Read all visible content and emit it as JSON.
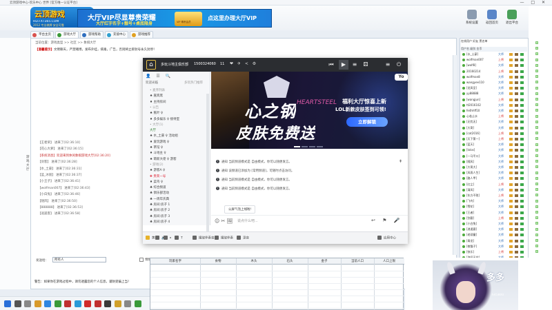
{
  "window": {
    "title": "云顶游戏中心-欢乐中心 世界 [官方唯一认证平台]",
    "controls": "— □ ✕"
  },
  "logo": {
    "main": "云顶游戏",
    "sub": "HD.FXT365.COM",
    "sub2": "2012 专业棋牌 安全可靠"
  },
  "banner": {
    "line1": "大厅VIP尽显尊贵荣耀",
    "line2": "大厅红字名字+靓号+桌底隐身",
    "badge": "VIP 尊贵会员",
    "line3": "点这里办理大厅VIP"
  },
  "toolbar": [
    {
      "label": "系统设置",
      "icon": "gear-icon",
      "color": "#8a9bb0"
    },
    {
      "label": "返回首页",
      "icon": "home-icon",
      "color": "#5a86c8"
    },
    {
      "label": "退出平台",
      "icon": "exit-icon",
      "color": "#4aa05a"
    }
  ],
  "tabs": [
    {
      "label": "平台主页",
      "color": "#d9534f"
    },
    {
      "label": "游戏大厅",
      "color": "#3a9a3a"
    },
    {
      "label": "游戏帮助",
      "color": "#2f6fbf"
    },
    {
      "label": "充值中心",
      "color": "#2f9fd0"
    },
    {
      "label": "游戏推荐",
      "color": "#e0a020"
    }
  ],
  "content": {
    "location": "当前位置：游戏类型 >> 社区 >> 象棋大厅",
    "notice_label": "【温馨提示】",
    "notice_text": "文明聊天，严禁赌博，发布外挂，病毒，广告，否则将立即封号永久封停！",
    "messages": [
      {
        "text": "【王者荣】 进来了[02:36:10]",
        "red": false
      },
      {
        "text": "【花心大萝】 进来了[02:36:15]",
        "red": false
      },
      {
        "text": "【系统消息】欢迎来到休闲象棋游戏大厅[02:36:20]",
        "red": true
      },
      {
        "text": "【剑客】 进来了[02:36:28]",
        "red": false
      },
      {
        "text": "【水_土豪】 进来了[02:36:31]",
        "red": false
      },
      {
        "text": "【蓝_冰丽】 进来了[02:36:37]",
        "red": false
      },
      {
        "text": "【小王子】 进来了[02:36:41]",
        "red": false
      },
      {
        "text": "【wolfman007】 进来了[02:36:43]",
        "red": false
      },
      {
        "text": "【小白兔】 进来了[02:36:46]",
        "red": false
      },
      {
        "text": "【随风】 进来了[02:36:50]",
        "red": false
      },
      {
        "text": "【888888】 进来了[02:36:53]",
        "red": false
      },
      {
        "text": "【逍遥客】 进来了[02:36:58]",
        "red": false
      }
    ],
    "side_label": "游戏大厅",
    "talk_label": "发送给：",
    "talk_target": "所有人",
    "private_label": "悄悄话",
    "warning": "警告：如果你在游戏过程中，请勿透露您的个人信息，谨防受骗上当！"
  },
  "right_panel": {
    "tabs": "在线用户  好友  黑名单",
    "header": "用户名  级别  金币",
    "users": [
      {
        "name": "[水_土豪]",
        "level": "大师",
        "red": false
      },
      {
        "name": "wolfman007",
        "level": "上将",
        "red": true
      },
      {
        "name": "[wolf8]",
        "level": "大师",
        "red": false
      },
      {
        "name": "20160214",
        "level": "上将",
        "red": true
      },
      {
        "name": "wolfman8",
        "level": "大师",
        "red": false
      },
      {
        "name": "wangyee110",
        "level": "大师",
        "red": false
      },
      {
        "name": "[龙凤呈]",
        "level": "大师",
        "red": false
      },
      {
        "name": "yy88888",
        "level": "大师",
        "red": false
      },
      {
        "name": "[wangjun]",
        "level": "上将",
        "red": true
      },
      {
        "name": "tt2016102",
        "level": "大师",
        "red": false
      },
      {
        "name": "fe4hhff10",
        "level": "大师",
        "red": false
      },
      {
        "name": "心若止水",
        "level": "上将",
        "red": true
      },
      {
        "name": "[无忧无]",
        "level": "大师",
        "red": false
      },
      {
        "name": "[大哥]",
        "level": "大师",
        "red": false
      },
      {
        "name": "[cat2016]",
        "level": "上将",
        "red": true
      },
      {
        "name": "[天下第一]",
        "level": "上将",
        "red": true
      },
      {
        "name": "[蓝天]",
        "level": "大师",
        "red": false
      },
      {
        "name": "[lolos]",
        "level": "大师",
        "red": false
      },
      {
        "name": "[一马平川]",
        "level": "大师",
        "red": false
      },
      {
        "name": "[随风]",
        "level": "大师",
        "red": false
      },
      {
        "name": "[大哥大]",
        "level": "大师",
        "red": false
      },
      {
        "name": "[风雨人生]",
        "level": "大师",
        "red": false
      },
      {
        "name": "[路人甲]",
        "level": "大师",
        "red": false
      },
      {
        "name": "[红尘]",
        "level": "上将",
        "red": true
      },
      {
        "name": "[清风]",
        "level": "大师",
        "red": false
      },
      {
        "name": "[东方不败]",
        "level": "上将",
        "red": true
      },
      {
        "name": "[飞鸟]",
        "level": "大师",
        "red": false
      },
      {
        "name": "[雪花]",
        "level": "大师",
        "red": false
      },
      {
        "name": "[王者]",
        "level": "大师",
        "red": false
      },
      {
        "name": "[剑客]",
        "level": "上将",
        "red": true
      },
      {
        "name": "[小白兔]",
        "level": "大师",
        "red": false
      },
      {
        "name": "[逍遥客]",
        "level": "大师",
        "red": false
      },
      {
        "name": "[老顽童]",
        "level": "大师",
        "red": false
      },
      {
        "name": "[青龙]",
        "level": "大师",
        "red": false
      },
      {
        "name": "[夜猫子]",
        "level": "大师",
        "red": false
      },
      {
        "name": "[快乐]",
        "level": "上将",
        "red": true
      },
      {
        "name": "[海阔天空]",
        "level": "大师",
        "red": false
      },
      {
        "name": "[一剑]",
        "level": "大师",
        "red": false
      },
      {
        "name": "[无名]",
        "level": "大师",
        "red": false
      },
      {
        "name": "[星辰]",
        "level": "大师",
        "red": false
      }
    ]
  },
  "overlay": {
    "room_name": "多玩斗地主俱乐部",
    "room_id": "1500324060",
    "count": "11",
    "icons": "❤ ✈ < ⚙",
    "top_buttons": [
      "⏮",
      "▶",
      "≡",
      "⚄",
      "≡",
      "⏻"
    ],
    "list_icons": "👤 ☰ 🔍",
    "list_header": "欢迎光临",
    "list_header_right": "多玩热门推荐",
    "tree": [
      {
        "text": "• 麦序列表",
        "color": "#999"
      },
      {
        "text": "   ♠ 嘉宾席",
        "color": "#444"
      },
      {
        "text": "   ♦ 主持房间",
        "color": "#444"
      },
      {
        "text": "• 公告",
        "color": "#999"
      },
      {
        "text": "   ♠ 蕉叶 ♀",
        "color": "#444"
      },
      {
        "text": "   ♦ 多多娱乐 ♀  接待室",
        "color": "#444"
      },
      {
        "text": "• 大厅(1)",
        "color": "#999"
      },
      {
        "text": "大厅",
        "color": "#2a7a2a"
      },
      {
        "text": "   ♠ 水_土豪 ♀  活动组",
        "color": "#444"
      },
      {
        "text": "   ♦ 爱玩游戏 ♀",
        "color": "#444"
      },
      {
        "text": "   ♠ 茶馆 ♀",
        "color": "#444"
      },
      {
        "text": "   ♦ 斗地主 ♀",
        "color": "#444"
      },
      {
        "text": "   ♠ 萌新大佬  ♀ 游客",
        "color": "#444"
      },
      {
        "text": "• 游戏(2)",
        "color": "#999"
      },
      {
        "text": "   ♠ 游客A ♀",
        "color": "#444"
      },
      {
        "text": "      ✚ 贵宾一号",
        "color": "#d23"
      },
      {
        "text": "   ♦ 菜鸟 ♀",
        "color": "#444"
      },
      {
        "text": "♣ 综合频道",
        "color": "#444"
      },
      {
        "text": "♣ 俱乐部活动",
        "color": "#444"
      },
      {
        "text": "♣ 一周年庆典",
        "color": "#444"
      },
      {
        "text": "♣ 房间:房子 1",
        "color": "#444"
      },
      {
        "text": "♣ 房间:房子 2",
        "color": "#444"
      },
      {
        "text": "♣ 房间:房子 3",
        "color": "#444"
      },
      {
        "text": "♣ 房间:房子 4",
        "color": "#444"
      }
    ],
    "ad": {
      "title1": "心之钢",
      "title1b": "HEARTSTEEL",
      "title2": "皮肤免费送",
      "right1": "福利大厅惊喜上新",
      "right2": "LOL新款皮肤签到可领!",
      "button": "立即解锁",
      "tag": "Yo"
    },
    "anchor": "⇞",
    "notices": [
      {
        "label": "通知",
        "text": "当前频道模式是 自由模式，你可以随便发言。"
      },
      {
        "label": "通知",
        "text": "该频道已添加为 [常用频道]，可随时点击访问。"
      },
      {
        "label": "通知",
        "text": "当前频道模式是 自由模式，你可以随便发言。"
      },
      {
        "label": "通知",
        "text": "当前频道模式是 自由模式，你可以随便发言。"
      }
    ],
    "welcome_button": "公屏气泡上线啦!",
    "input_placeholder": "说点什么吧...",
    "emoji_icons": "☺ ✂ 🖼",
    "send_icons": "↩ ⚑ 🎤",
    "bottom": [
      {
        "label": "黄色",
        "color": "#e7b22b"
      },
      {
        "label": "🔊",
        "color": "#666"
      },
      {
        "label": "⏸",
        "color": "#666"
      },
      {
        "label": "T",
        "color": "#666"
      },
      {
        "label": "播放伴奏音乐",
        "color": "#666"
      },
      {
        "label": "播放伴奏",
        "color": "#666"
      },
      {
        "label": "录音",
        "color": "#666"
      },
      {
        "label": "应用中心",
        "color": "#666"
      }
    ]
  },
  "table": {
    "headers": [
      "玩家名字",
      "食物",
      "木头",
      "石头",
      "金子",
      "当前人口",
      "人口上限"
    ]
  },
  "avatar": {
    "text": "多多",
    "tag": "645800"
  }
}
